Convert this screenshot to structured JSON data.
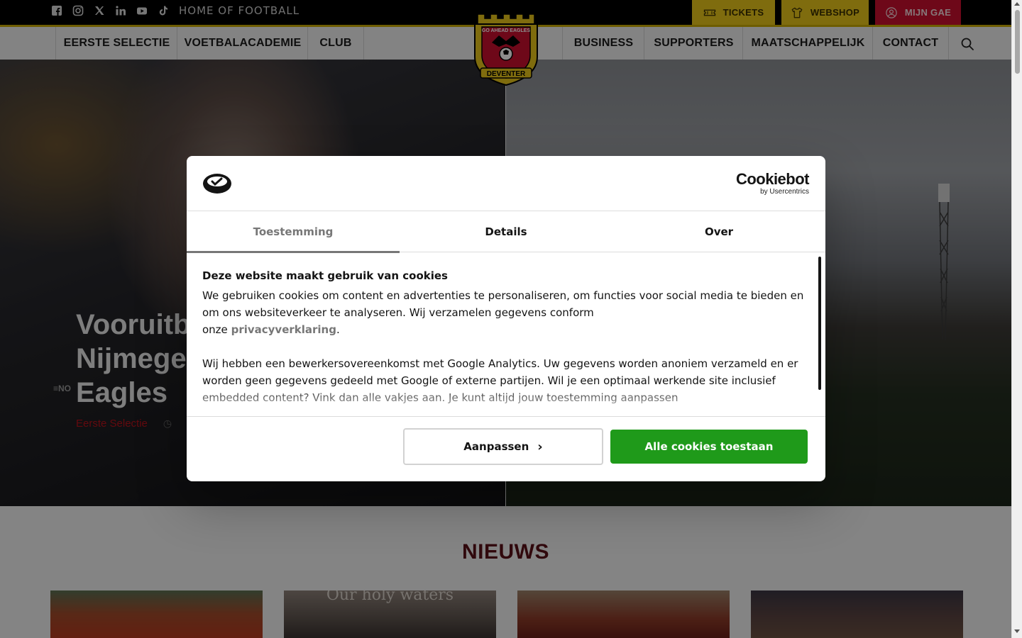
{
  "topbar": {
    "tagline": "HOME OF FOOTBALL",
    "socials": [
      "facebook-icon",
      "instagram-icon",
      "x-icon",
      "linkedin-icon",
      "youtube-icon",
      "tiktok-icon"
    ],
    "tickets_label": "TICKETS",
    "webshop_label": "WEBSHOP",
    "mijn_label": "MIJN GAE"
  },
  "nav": {
    "left": [
      "EERSTE SELECTIE",
      "VOETBALACADEMIE",
      "CLUB"
    ],
    "right": [
      "BUSINESS",
      "SUPPORTERS",
      "MAATSCHAPPELIJK",
      "CONTACT"
    ]
  },
  "logo": {
    "top_text": "GO AHEAD EAGLES",
    "bottom_text": "DEVENTER"
  },
  "hero": {
    "title_lines": [
      "Vooruitb",
      "Nijmegen",
      "Eagles"
    ],
    "category": "Eerste Selectie",
    "brand_mark": "≡NO"
  },
  "news": {
    "title": "NIEUWS",
    "card2_text": "Our holy waters"
  },
  "cookie_dialog": {
    "brand_name": "Cookiebot",
    "brand_sub": "by Usercentrics",
    "tabs": [
      "Toestemming",
      "Details",
      "Over"
    ],
    "active_tab": "Toestemming",
    "heading": "Deze website maakt gebruik van cookies",
    "p1": "We gebruiken cookies om content en advertenties te personaliseren, om functies voor social media te bieden en om ons websiteverkeer te analyseren. Wij verzamelen gegevens conform",
    "p1_prefix": "onze",
    "privacy_link": "privacyverklaring",
    "p1_suffix": ".",
    "p2": "Wij hebben een bewerkersovereenkomst met Google Analytics. Uw gegevens worden anoniem verzameld en er worden geen gegevens gedeeld met Google of externe partijen. Wil je een optimaal werkende site inclusief embedded content? Vink dan alle vakjes aan. Je kunt altijd jouw toestemming aanpassen",
    "customize_label": "Aanpassen",
    "allow_all_label": "Alle cookies toestaan"
  },
  "colors": {
    "accent_yellow": "#e7c51b",
    "accent_red": "#c8102e",
    "allow_green": "#1f9a1a",
    "news_title": "#5a1219"
  }
}
